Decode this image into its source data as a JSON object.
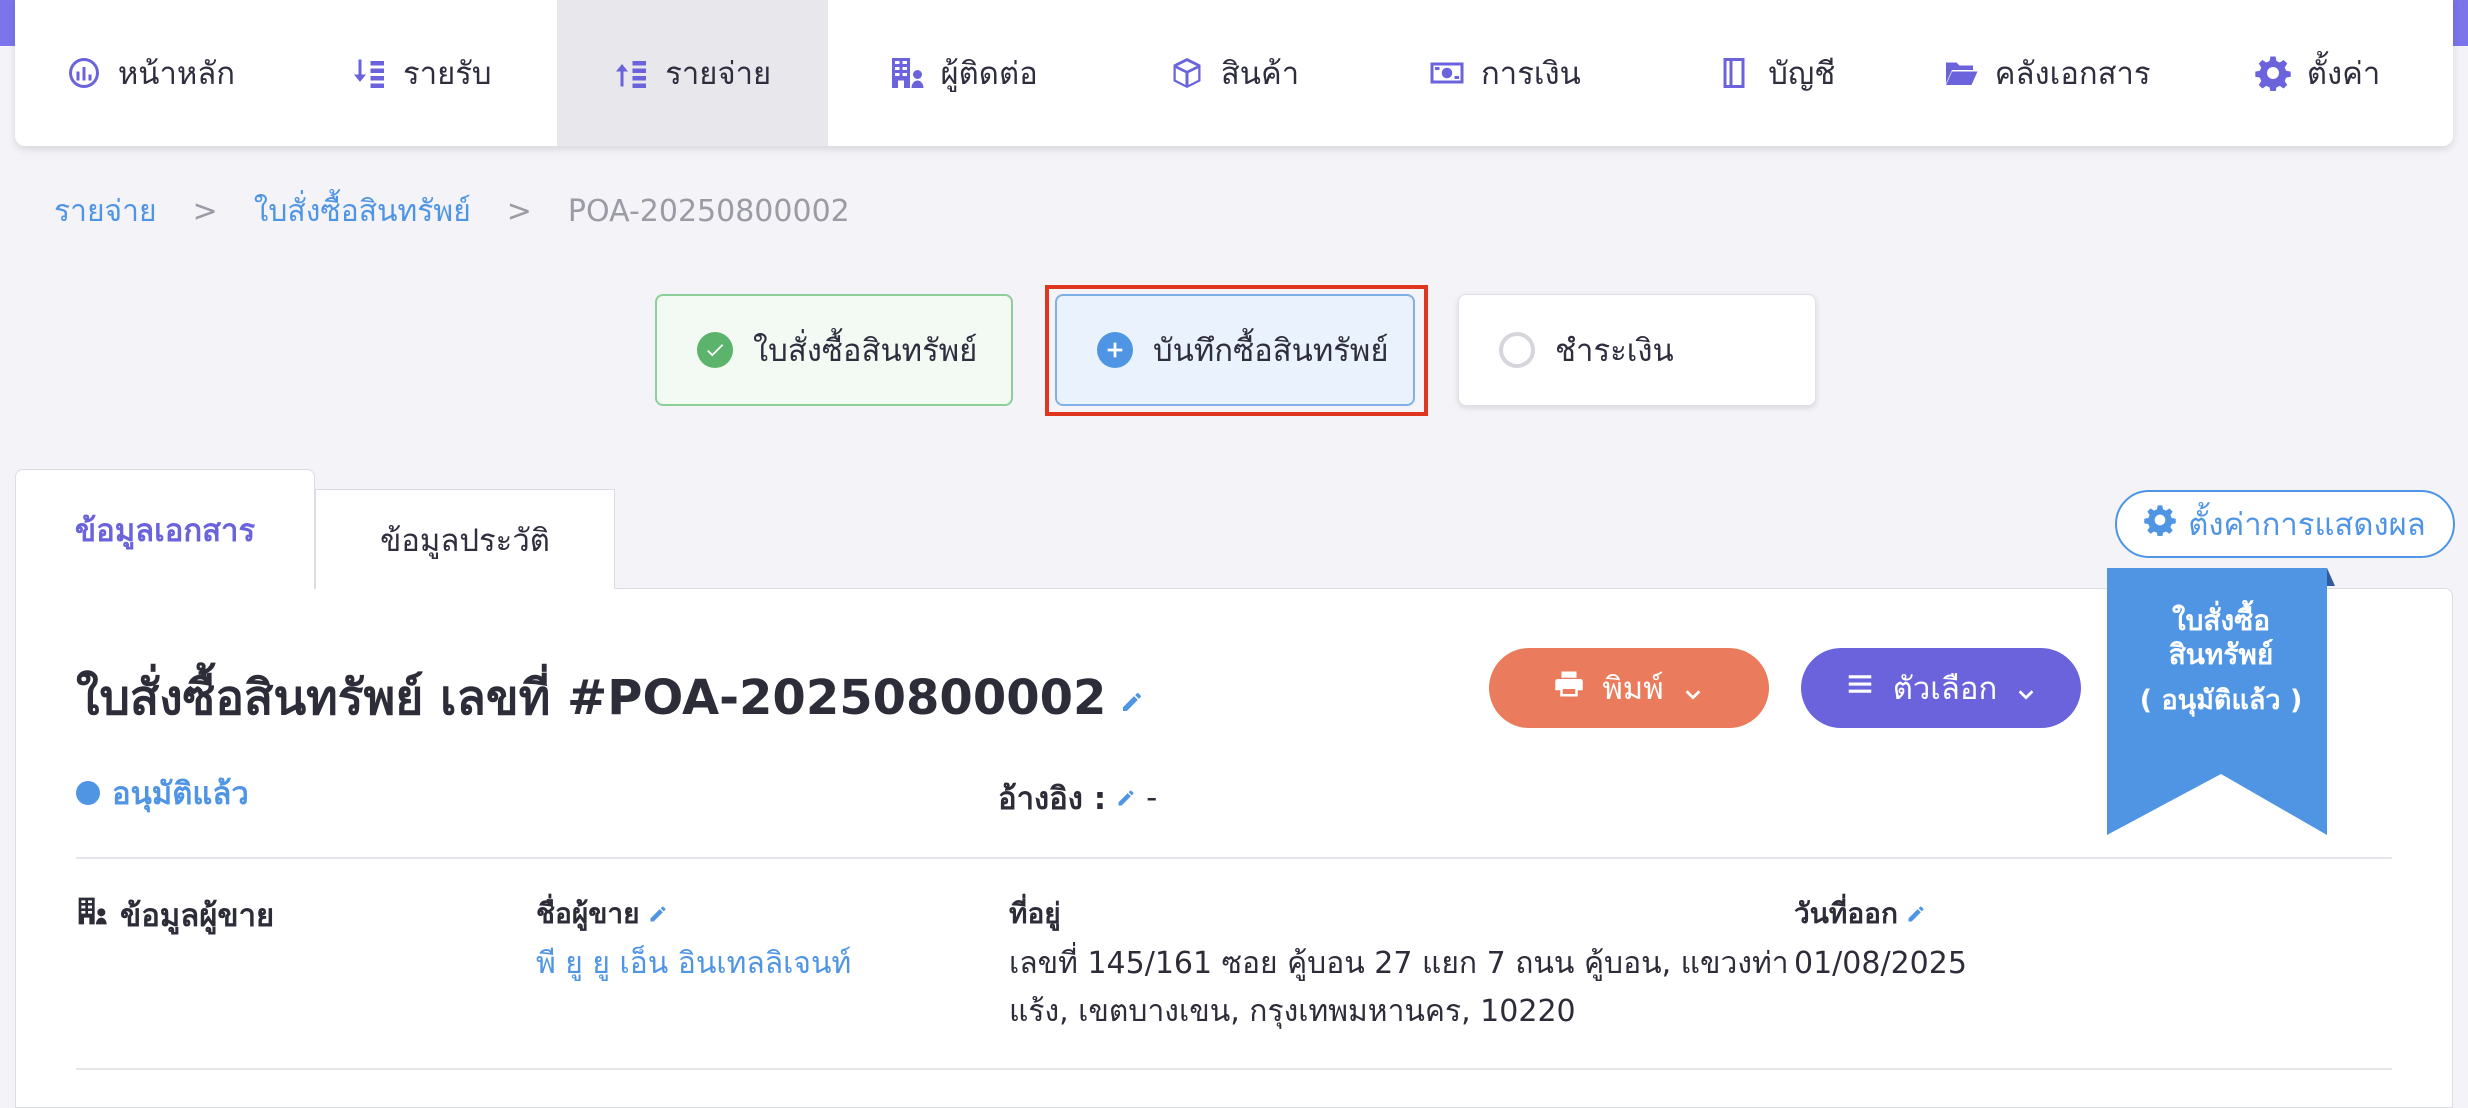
{
  "nav": {
    "items": [
      {
        "label": "หน้าหลัก",
        "icon": "dashboard-icon"
      },
      {
        "label": "รายรับ",
        "icon": "income-icon"
      },
      {
        "label": "รายจ่าย",
        "icon": "expense-icon",
        "active": true
      },
      {
        "label": "ผู้ติดต่อ",
        "icon": "contact-icon"
      },
      {
        "label": "สินค้า",
        "icon": "box-icon"
      },
      {
        "label": "การเงิน",
        "icon": "money-icon"
      },
      {
        "label": "บัญชี",
        "icon": "book-icon"
      },
      {
        "label": "คลังเอกสาร",
        "icon": "folder-icon"
      },
      {
        "label": "ตั้งค่า",
        "icon": "gear-icon"
      }
    ]
  },
  "breadcrumb": {
    "items": [
      "รายจ่าย",
      "ใบสั่งซื้อสินทรัพย์"
    ],
    "separator": ">",
    "current": "POA-20250800002"
  },
  "steps": [
    {
      "label": "ใบสั่งซื้อสินทรัพย์",
      "state": "done"
    },
    {
      "label": "บันทึกซื้อสินทรัพย์",
      "state": "add"
    },
    {
      "label": "ชำระเงิน",
      "state": "pending"
    }
  ],
  "tabs": {
    "document": "ข้อมูลเอกสาร",
    "history": "ข้อมูลประวัติ"
  },
  "display_settings_label": "ตั้งค่าการแสดงผล",
  "document": {
    "title": "ใบสั่งซื้อสินทรัพย์ เลขที่ #POA-20250800002",
    "print_label": "พิมพ์",
    "options_label": "ตัวเลือก",
    "ribbon_line1": "ใบสั่งซื้อ",
    "ribbon_line2": "สินทรัพย์",
    "ribbon_status": "( อนุมัติแล้ว )",
    "status": "อนุมัติแล้ว",
    "reference_label": "อ้างอิง :",
    "reference_value": "-"
  },
  "vendor": {
    "section_title": "ข้อมูลผู้ขาย",
    "name_label": "ชื่อผู้ขาย",
    "name_value": "พี ยู ยู เอ็น อินเทลลิเจนท์",
    "address_label": "ที่อยู่",
    "address_line1": "เลขที่ 145/161 ซอย คู้บอน 27 แยก 7 ถนน คู้บอน, แขวงท่า",
    "address_line2": "แร้ง, เขตบางเขน, กรุงเทพมหานคร, 10220",
    "issue_date_label": "วันที่ออก",
    "issue_date_value": "01/08/2025"
  },
  "colors": {
    "brand": "#6a63db",
    "link": "#4f95e3",
    "print": "#ea7b5c",
    "success": "#5cb46c",
    "highlight": "#e0351f"
  }
}
